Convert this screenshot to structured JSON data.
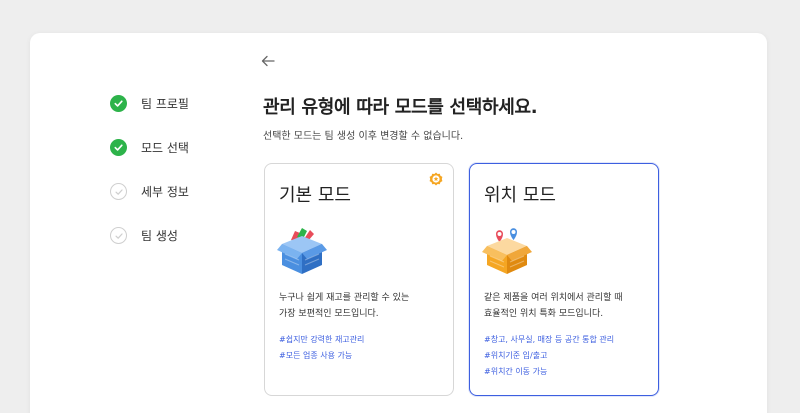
{
  "steps": [
    {
      "label": "팀 프로필",
      "status": "done"
    },
    {
      "label": "모드 선택",
      "status": "done"
    },
    {
      "label": "세부 정보",
      "status": "todo"
    },
    {
      "label": "팀 생성",
      "status": "todo"
    }
  ],
  "header": {
    "title": "관리 유형에 따라 모드를 선택하세요.",
    "subtitle": "선택한 모드는 팀 생성 이후 변경할 수 없습니다."
  },
  "cards": [
    {
      "title": "기본 모드",
      "desc_line1": "누구나 쉽게 재고를 관리할 수 있는",
      "desc_line2": "가장 보편적인 모드입니다.",
      "tags": [
        "#쉽지만 강력한 재고관리",
        "#모든 업종 사용 가능"
      ]
    },
    {
      "title": "위치 모드",
      "desc_line1": "같은 제품을 여러 위치에서 관리할 때",
      "desc_line2": "효율적인 위치 특화 모드입니다.",
      "tags": [
        "#창고, 사무실, 매장 등 공간 통합 관리",
        "#위치기준 입/출고",
        "#위치간 이동 가능"
      ]
    }
  ],
  "colors": {
    "accent": "#3d5fe0",
    "done": "#2db34a",
    "badge": "#f5a623",
    "box_blue": "#4a8fe0",
    "box_orange": "#f5a623"
  },
  "icons": {
    "back": "arrow-left-icon",
    "done": "check-circle-icon",
    "todo": "check-circle-outline-icon",
    "badge": "star-badge-icon"
  }
}
